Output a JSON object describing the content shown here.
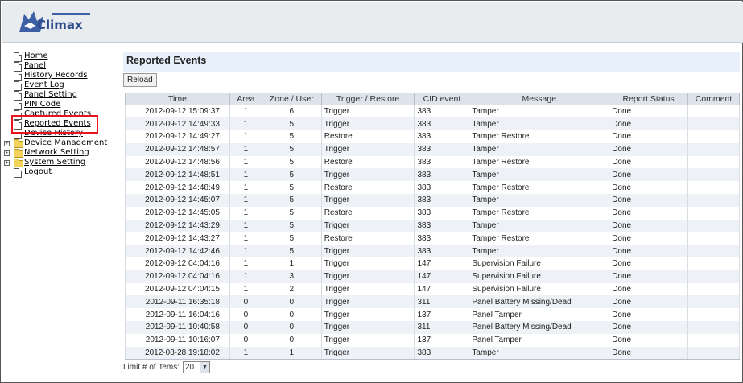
{
  "header": {
    "logo_text": "Climax"
  },
  "sidebar": {
    "items": [
      {
        "label": "Home",
        "icon": "doc-icon",
        "expandable": false
      },
      {
        "label": "Panel",
        "icon": "doc-icon",
        "expandable": false
      },
      {
        "label": "History Records",
        "icon": "doc-icon",
        "expandable": false
      },
      {
        "label": "Event Log",
        "icon": "doc-icon",
        "expandable": false
      },
      {
        "label": "Panel Setting",
        "icon": "doc-icon",
        "expandable": false
      },
      {
        "label": "PIN Code",
        "icon": "doc-icon",
        "expandable": false
      },
      {
        "label": "Captured Events",
        "icon": "doc-icon",
        "expandable": false
      },
      {
        "label": "Reported Events",
        "icon": "doc-icon",
        "expandable": false
      },
      {
        "label": "Device History",
        "icon": "doc-icon",
        "expandable": false
      },
      {
        "label": "Device Management",
        "icon": "folder-icon",
        "expandable": true
      },
      {
        "label": "Network Setting",
        "icon": "folder-icon",
        "expandable": true
      },
      {
        "label": "System Setting",
        "icon": "folder-icon",
        "expandable": true
      },
      {
        "label": "Logout",
        "icon": "doc-icon",
        "expandable": false
      }
    ],
    "highlight_color": "#e8141e"
  },
  "main": {
    "title": "Reported Events",
    "reload_label": "Reload",
    "columns": [
      "Time",
      "Area",
      "Zone / User",
      "Trigger / Restore",
      "CID event",
      "Message",
      "Report Status",
      "Comment"
    ],
    "rows": [
      [
        "2012-09-12 15:09:37",
        "1",
        "6",
        "Trigger",
        "383",
        "Tamper",
        "Done",
        ""
      ],
      [
        "2012-09-12 14:49:33",
        "1",
        "5",
        "Trigger",
        "383",
        "Tamper",
        "Done",
        ""
      ],
      [
        "2012-09-12 14:49:27",
        "1",
        "5",
        "Restore",
        "383",
        "Tamper Restore",
        "Done",
        ""
      ],
      [
        "2012-09-12 14:48:57",
        "1",
        "5",
        "Trigger",
        "383",
        "Tamper",
        "Done",
        ""
      ],
      [
        "2012-09-12 14:48:56",
        "1",
        "5",
        "Restore",
        "383",
        "Tamper Restore",
        "Done",
        ""
      ],
      [
        "2012-09-12 14:48:51",
        "1",
        "5",
        "Trigger",
        "383",
        "Tamper",
        "Done",
        ""
      ],
      [
        "2012-09-12 14:48:49",
        "1",
        "5",
        "Restore",
        "383",
        "Tamper Restore",
        "Done",
        ""
      ],
      [
        "2012-09-12 14:45:07",
        "1",
        "5",
        "Trigger",
        "383",
        "Tamper",
        "Done",
        ""
      ],
      [
        "2012-09-12 14:45:05",
        "1",
        "5",
        "Restore",
        "383",
        "Tamper Restore",
        "Done",
        ""
      ],
      [
        "2012-09-12 14:43:29",
        "1",
        "5",
        "Trigger",
        "383",
        "Tamper",
        "Done",
        ""
      ],
      [
        "2012-09-12 14:43:27",
        "1",
        "5",
        "Restore",
        "383",
        "Tamper Restore",
        "Done",
        ""
      ],
      [
        "2012-09-12 14:42:46",
        "1",
        "5",
        "Trigger",
        "383",
        "Tamper",
        "Done",
        ""
      ],
      [
        "2012-09-12 04:04:16",
        "1",
        "1",
        "Trigger",
        "147",
        "Supervision Failure",
        "Done",
        ""
      ],
      [
        "2012-09-12 04:04:16",
        "1",
        "3",
        "Trigger",
        "147",
        "Supervision Failure",
        "Done",
        ""
      ],
      [
        "2012-09-12 04:04:15",
        "1",
        "2",
        "Trigger",
        "147",
        "Supervision Failure",
        "Done",
        ""
      ],
      [
        "2012-09-11 16:35:18",
        "0",
        "0",
        "Trigger",
        "311",
        "Panel Battery Missing/Dead",
        "Done",
        ""
      ],
      [
        "2012-09-11 16:04:16",
        "0",
        "0",
        "Trigger",
        "137",
        "Panel Tamper",
        "Done",
        ""
      ],
      [
        "2012-09-11 10:40:58",
        "0",
        "0",
        "Trigger",
        "311",
        "Panel Battery Missing/Dead",
        "Done",
        ""
      ],
      [
        "2012-09-11 10:16:07",
        "0",
        "0",
        "Trigger",
        "137",
        "Panel Tamper",
        "Done",
        ""
      ],
      [
        "2012-08-28 19:18:02",
        "1",
        "1",
        "Trigger",
        "383",
        "Tamper",
        "Done",
        ""
      ]
    ],
    "limit_label": "Limit # of items:",
    "limit_value": "20"
  }
}
